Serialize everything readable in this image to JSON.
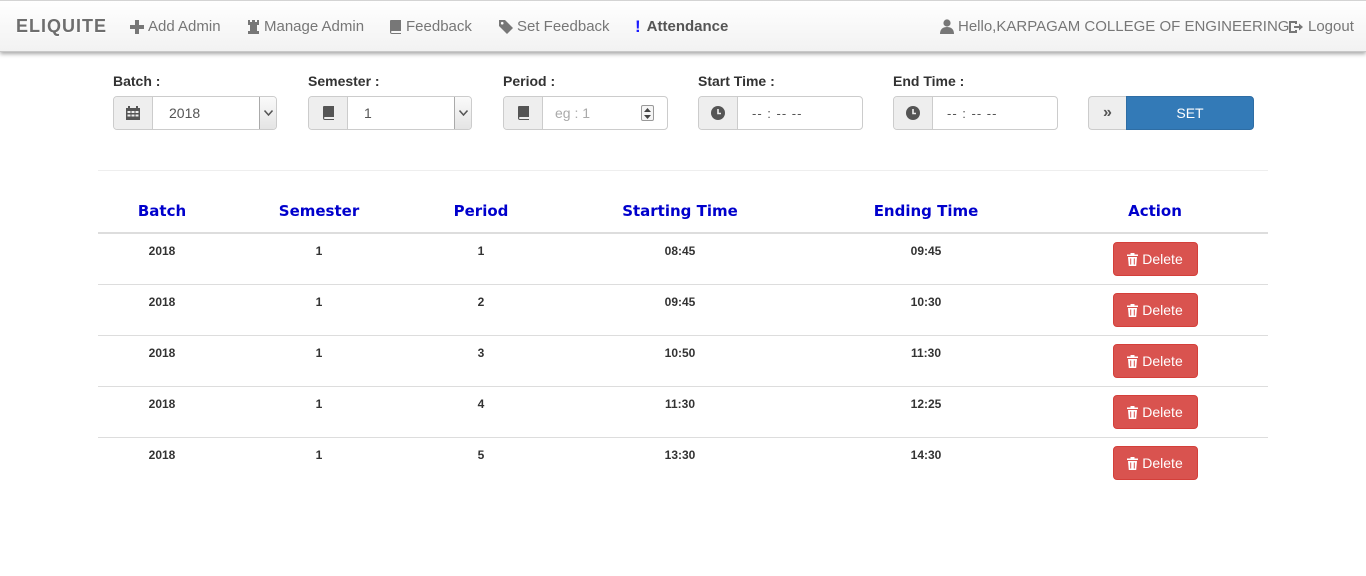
{
  "navbar": {
    "brand": "ELIQUITE",
    "items": [
      {
        "label": "Add Admin",
        "icon": "plus-icon"
      },
      {
        "label": "Manage Admin",
        "icon": "tower-icon"
      },
      {
        "label": "Feedback",
        "icon": "book-icon"
      },
      {
        "label": "Set Feedback",
        "icon": "tag-icon"
      },
      {
        "label": "Attendance",
        "icon": "exclamation-icon"
      }
    ],
    "user": "Hello,KARPAGAM COLLEGE OF ENGINEERING",
    "logout": "Logout"
  },
  "form": {
    "batch": {
      "label": "Batch :",
      "value": "2018"
    },
    "semester": {
      "label": "Semester :",
      "value": "1"
    },
    "period": {
      "label": "Period :",
      "placeholder": "eg : 1"
    },
    "start_time": {
      "label": "Start Time :",
      "placeholder": "-- : --  --"
    },
    "end_time": {
      "label": "End Time :",
      "placeholder": "-- : --  --"
    },
    "set_addon": "»",
    "set_button": "SET"
  },
  "table": {
    "headers": [
      "Batch",
      "Semester",
      "Period",
      "Starting Time",
      "Ending Time",
      "Action"
    ],
    "rows": [
      {
        "batch": "2018",
        "semester": "1",
        "period": "1",
        "start": "08:45",
        "end": "09:45",
        "action": "Delete"
      },
      {
        "batch": "2018",
        "semester": "1",
        "period": "2",
        "start": "09:45",
        "end": "10:30",
        "action": "Delete"
      },
      {
        "batch": "2018",
        "semester": "1",
        "period": "3",
        "start": "10:50",
        "end": "11:30",
        "action": "Delete"
      },
      {
        "batch": "2018",
        "semester": "1",
        "period": "4",
        "start": "11:30",
        "end": "12:25",
        "action": "Delete"
      },
      {
        "batch": "2018",
        "semester": "1",
        "period": "5",
        "start": "13:30",
        "end": "14:30",
        "action": "Delete"
      }
    ]
  },
  "colors": {
    "header_text": "#0000cc",
    "primary": "#337ab7",
    "danger": "#d9534f",
    "attendance_mark": "#1a1aff"
  }
}
